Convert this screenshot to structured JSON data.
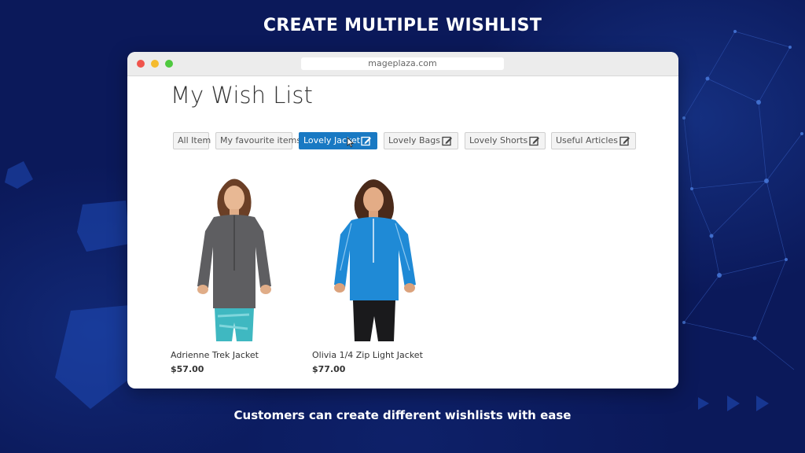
{
  "banner": {
    "headline": "CREATE MULTIPLE WISHLIST",
    "caption": "Customers can create different wishlists with ease"
  },
  "browser": {
    "url": "mageplaza.com"
  },
  "page": {
    "title": "My Wish List"
  },
  "tabs": [
    {
      "label": "All Item",
      "editable": false,
      "active": false
    },
    {
      "label": "My favourite items",
      "editable": false,
      "active": false
    },
    {
      "label": "Lovely Jacket",
      "editable": true,
      "active": true
    },
    {
      "label": "Lovely Bags",
      "editable": true,
      "active": false
    },
    {
      "label": "Lovely Shorts",
      "editable": true,
      "active": false
    },
    {
      "label": "Useful Articles",
      "editable": true,
      "active": false
    }
  ],
  "products": [
    {
      "name": "Adrienne Trek Jacket",
      "price": "$57.00",
      "image": "woman-in-gray-jacket"
    },
    {
      "name": "Olivia 1/4 Zip Light Jacket",
      "price": "$77.00",
      "image": "woman-in-blue-jacket"
    }
  ],
  "colors": {
    "background": "#0b195a",
    "active_tab": "#1979c3",
    "tab_bg": "#f3f3f3"
  }
}
